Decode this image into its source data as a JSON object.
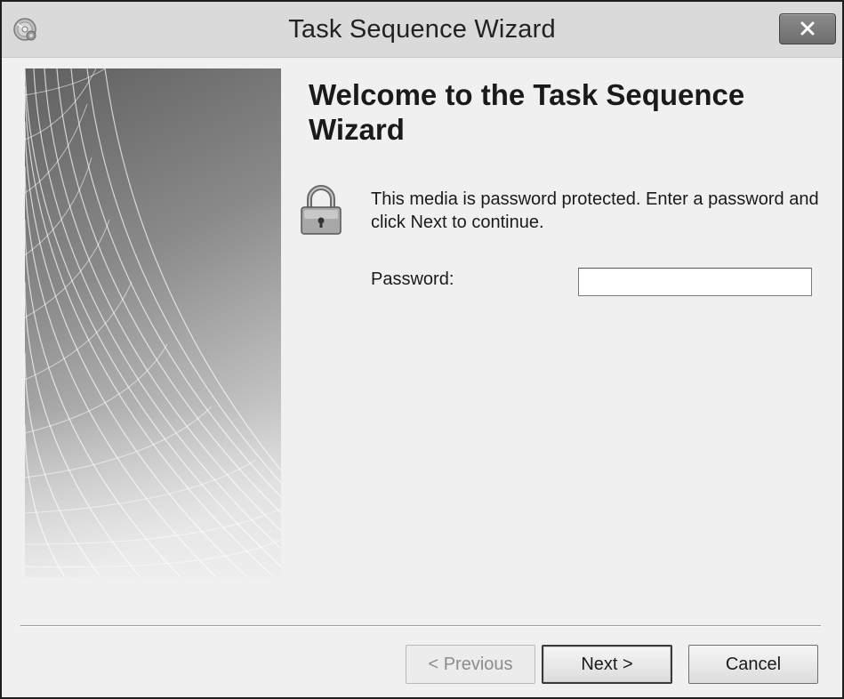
{
  "window": {
    "title": "Task Sequence Wizard",
    "icons": {
      "app": "cd-disc-icon",
      "close": "close-icon"
    }
  },
  "welcome": {
    "heading": "Welcome to the Task Sequence Wizard",
    "lock_icon": "lock-icon",
    "message": "This media is password protected.  Enter a password and click Next to continue."
  },
  "password": {
    "label": "Password:",
    "value": "",
    "placeholder": ""
  },
  "buttons": {
    "previous": "< Previous",
    "next": "Next >",
    "cancel": "Cancel"
  },
  "colors": {
    "titlebar": "#dadada",
    "dialog_background": "#f0f0f0",
    "close_button": "#7a7a7a"
  }
}
